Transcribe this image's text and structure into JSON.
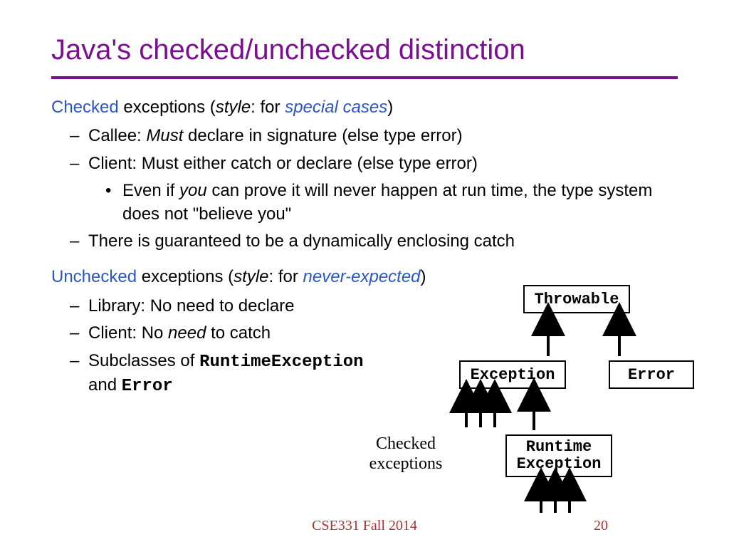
{
  "title": "Java's checked/unchecked distinction",
  "checked": {
    "word": "Checked",
    "rest1": " exceptions (",
    "style": "style",
    "rest2": ": for ",
    "special": "special cases",
    "rest3": ")",
    "b1a": "Callee:  ",
    "b1_must": "Must",
    "b1b": " declare in signature (else type error)",
    "b2": "Client:  Must either catch or declare (else type error)",
    "b2sub_a": "Even if ",
    "b2sub_you": "you",
    "b2sub_b": " can prove it will never happen at run time, the type system does not \"believe you\"",
    "b3": "There is guaranteed to be a dynamically enclosing catch"
  },
  "unchecked": {
    "word": "Unchecked",
    "rest1": " exceptions (",
    "style": "style",
    "rest2": ": for ",
    "never": "never-expected",
    "rest3": ")",
    "b1": "Library:  No need to declare",
    "b2a": "Client:  No ",
    "b2_need": "need",
    "b2b": " to catch",
    "b3a": "Subclasses of ",
    "b3_rt": "RuntimeException",
    "b3b": "and ",
    "b3_err": "Error"
  },
  "diagram": {
    "throwable": "Throwable",
    "exception": "Exception",
    "error": "Error",
    "runtime1": "Runtime",
    "runtime2": "Exception",
    "checked_label": "Checked exceptions"
  },
  "footer": {
    "course": "CSE331 Fall 2014",
    "page": "20"
  }
}
